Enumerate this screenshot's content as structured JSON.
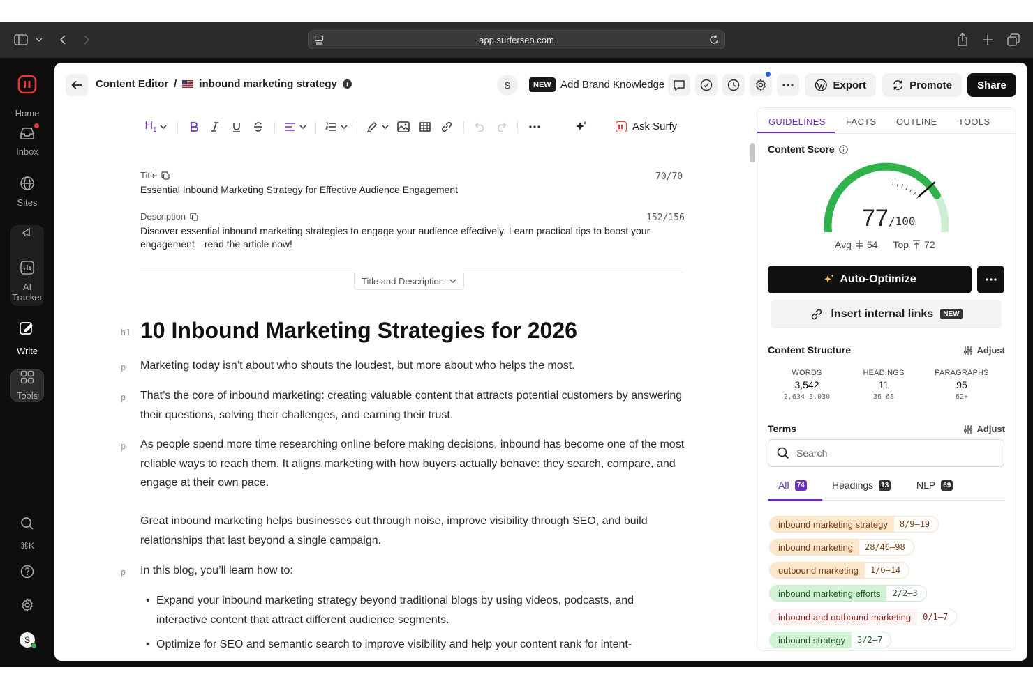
{
  "browser": {
    "url": "app.surferseo.com"
  },
  "sidebar": {
    "items": [
      {
        "label": "Home"
      },
      {
        "label": "Inbox"
      },
      {
        "label": "Sites"
      },
      {
        "label": "AI Tracker"
      },
      {
        "label": "Write"
      },
      {
        "label": "Tools"
      }
    ],
    "shortcut": "⌘K",
    "avatar_letter": "S"
  },
  "header": {
    "breadcrumb_root": "Content Editor",
    "breadcrumb_sep": "/",
    "document": "inbound marketing strategy",
    "avatar_letter": "S",
    "new_badge": "NEW",
    "brand_knowledge": "Add Brand Knowledge",
    "export_label": "Export",
    "promote_label": "Promote",
    "share_label": "Share"
  },
  "toolbar": {
    "heading_label": "H",
    "heading_sub": "1",
    "ask_surfy": "Ask Surfy"
  },
  "meta": {
    "title_label": "Title",
    "title_count": "70/70",
    "title_value": "Essential Inbound Marketing Strategy for Effective Audience Engagement",
    "desc_label": "Description",
    "desc_count": "152/156",
    "desc_value": "Discover essential inbound marketing strategies to engage your audience effectively. Learn practical tips to boost your engagement—read the article now!",
    "toggle_label": "Title and Description"
  },
  "article": {
    "h1_tag": "h1",
    "p_tag": "p",
    "h1": "10 Inbound Marketing Strategies for 2026",
    "p1": "Marketing today isn’t about who shouts the loudest, but more about who helps the most.",
    "p2": "That’s the core of inbound marketing: creating valuable content that attracts potential customers by answering their questions, solving their challenges, and earning their trust.",
    "p3": "As people spend more time researching online before making decisions, inbound has become one of the most reliable ways to reach them. It aligns marketing with how buyers actually behave: they search, compare, and engage at their own pace.",
    "p4": "Great inbound marketing helps businesses cut through noise, improve visibility through SEO, and build relationships that last beyond a single campaign.",
    "p5": "In this blog, you’ll learn how to:",
    "bullets": [
      "Expand your inbound marketing strategy beyond traditional blogs by using videos, podcasts, and interactive content that attract different audience segments.",
      "Optimize for SEO and semantic search to improve visibility and help your content rank for intent-"
    ]
  },
  "panel": {
    "tabs": [
      "GUIDELINES",
      "FACTS",
      "OUTLINE",
      "TOOLS"
    ],
    "content_score_title": "Content Score",
    "score": "77",
    "score_max": "/100",
    "score_value": 77,
    "avg_label": "Avg",
    "avg_value": "54",
    "top_label": "Top",
    "top_value": "72",
    "auto_optimize": "Auto-Optimize",
    "insert_links": "Insert internal links",
    "insert_badge": "NEW",
    "structure_title": "Content Structure",
    "adjust_label": "Adjust",
    "stats": [
      {
        "key": "WORDS",
        "value": "3,542",
        "range": "2,634–3,030"
      },
      {
        "key": "HEADINGS",
        "value": "11",
        "range": "36–68"
      },
      {
        "key": "PARAGRAPHS",
        "value": "95",
        "range": "62+"
      }
    ],
    "terms_title": "Terms",
    "search_placeholder": "Search",
    "filter_tabs": [
      {
        "label": "All",
        "count": "74"
      },
      {
        "label": "Headings",
        "count": "13"
      },
      {
        "label": "NLP",
        "count": "69"
      }
    ],
    "terms": [
      {
        "name": "inbound marketing strategy",
        "count": "8/9–19",
        "status": "orange"
      },
      {
        "name": "inbound marketing",
        "count": "28/46–98",
        "status": "orange"
      },
      {
        "name": "outbound marketing",
        "count": "1/6–14",
        "status": "orange"
      },
      {
        "name": "inbound marketing efforts",
        "count": "2/2–3",
        "status": "green"
      },
      {
        "name": "inbound and outbound marketing",
        "count": "0/1–7",
        "status": "red"
      },
      {
        "name": "inbound strategy",
        "count": "3/2–7",
        "status": "green"
      }
    ]
  },
  "colors": {
    "accent": "#6b2fbf",
    "score_green": "#2fb24c",
    "brand_red": "#e53935"
  }
}
